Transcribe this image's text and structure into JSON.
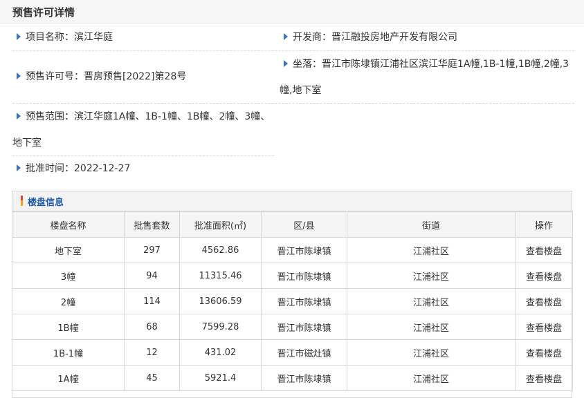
{
  "page": {
    "title": "预售许可详情"
  },
  "info": {
    "project_name": "项目名称：滨江华庭",
    "developer": "开发商：晋江融投房地产开发有限公司",
    "permit_no": "预售许可号：晋房预售[2022]第28号",
    "location": "坐落：晋江市陈埭镇江浦社区滨江华庭1A幢,1B-1幢,1B幢,2幢,3幢,地下室",
    "scope": "预售范围：滨江华庭1A幢、1B-1幢、1B幢、2幢、3幢、地下室",
    "approval_date": "批准时间：2022-12-27"
  },
  "buildings": {
    "title": "楼盘信息",
    "columns": [
      "楼盘名称",
      "批售套数",
      "批准面积(㎡)",
      "区/县",
      "街道",
      "操作"
    ],
    "rows": [
      {
        "name": "地下室",
        "units": "297",
        "area": "4562.86",
        "district": "晋江市陈埭镇",
        "street": "江浦社区",
        "action": "查看楼盘"
      },
      {
        "name": "3幢",
        "units": "94",
        "area": "11315.46",
        "district": "晋江市陈埭镇",
        "street": "江浦社区",
        "action": "查看楼盘"
      },
      {
        "name": "2幢",
        "units": "114",
        "area": "13606.59",
        "district": "晋江市陈埭镇",
        "street": "江浦社区",
        "action": "查看楼盘"
      },
      {
        "name": "1B幢",
        "units": "68",
        "area": "7599.28",
        "district": "晋江市陈埭镇",
        "street": "江浦社区",
        "action": "查看楼盘"
      },
      {
        "name": "1B-1幢",
        "units": "12",
        "area": "431.02",
        "district": "晋江市磁灶镇",
        "street": "江浦社区",
        "action": "查看楼盘"
      },
      {
        "name": "1A幢",
        "units": "45",
        "area": "5921.4",
        "district": "晋江市陈埭镇",
        "street": "江浦社区",
        "action": "查看楼盘"
      }
    ]
  }
}
